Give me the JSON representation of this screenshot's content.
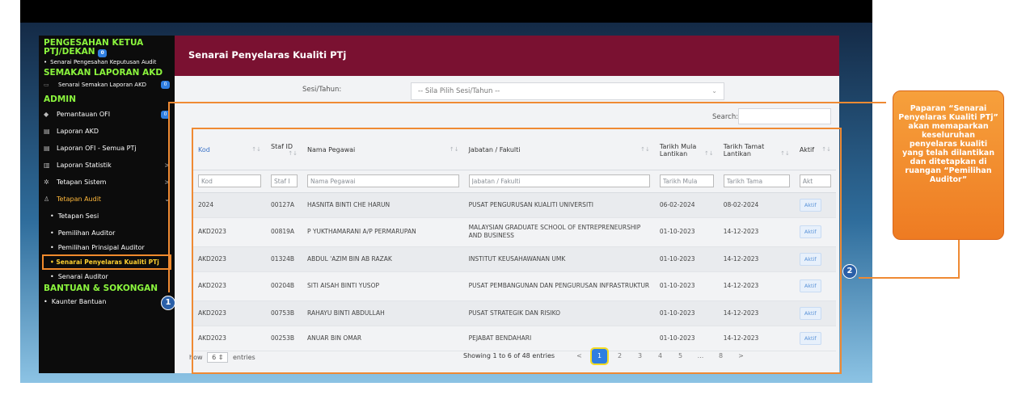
{
  "sidebar": {
    "section1": {
      "title": "PENGESAHAN KETUA PTJ/DEKAN",
      "badge": "0",
      "item": "Senarai Pengesahan Keputusan Audit"
    },
    "section2": {
      "title": "SEMAKAN LAPORAN AKD",
      "item": "Senarai Semakan Laporan AKD",
      "badge": "0"
    },
    "section3": {
      "title": "ADMIN"
    },
    "admin_items": [
      {
        "label": "Pemantauan OFI",
        "badge": "0"
      },
      {
        "label": "Laporan AKD"
      },
      {
        "label": "Laporan OFI - Semua PTj"
      },
      {
        "label": "Laporan Statistik",
        "arrow": ">"
      },
      {
        "label": "Tetapan Sistem",
        "arrow": ">"
      },
      {
        "label": "Tetapan Audit",
        "arrow": "⌄"
      }
    ],
    "audit_sub": [
      "Tetapan Sesi",
      "Pemilihan Auditor",
      "Pemilihan Prinsipal Auditor"
    ],
    "active_item": "Senarai Penyelaras Kualiti PTj",
    "after_active": "Senarai Auditor",
    "section4": {
      "title": "BANTUAN & SOKONGAN",
      "item": "Kaunter Bantuan"
    }
  },
  "main": {
    "title": "Senarai Penyelaras Kualiti PTj",
    "filter_label": "Sesi/Tahun:",
    "filter_placeholder": "-- Sila Pilih Sesi/Tahun --",
    "search_label": "Search:"
  },
  "table": {
    "headers": [
      "Kod",
      "Staf ID",
      "Nama Pegawai",
      "Jabatan / Fakulti",
      "Tarikh Mula Lantikan",
      "Tarikh Tamat Lantikan",
      "Aktif"
    ],
    "filter_placeholders": [
      "Kod",
      "Staf I",
      "Nama Pegawai",
      "Jabatan / Fakulti",
      "Tarikh Mula",
      "Tarikh Tama",
      "Akt"
    ],
    "rows": [
      [
        "2024",
        "00127A",
        "HASNITA BINTI CHE HARUN",
        "PUSAT PENGURUSAN KUALITI UNIVERSITI",
        "06-02-2024",
        "08-02-2024",
        "Aktif"
      ],
      [
        "AKD2023",
        "00819A",
        "P YUKTHAMARANI A/P PERMARUPAN",
        "MALAYSIAN GRADUATE SCHOOL OF ENTREPRENEURSHIP AND BUSINESS",
        "01-10-2023",
        "14-12-2023",
        "Aktif"
      ],
      [
        "AKD2023",
        "01324B",
        "ABDUL 'AZIM BIN AB RAZAK",
        "INSTITUT KEUSAHAWANAN UMK",
        "01-10-2023",
        "14-12-2023",
        "Aktif"
      ],
      [
        "AKD2023",
        "00204B",
        "SITI AISAH BINTI YUSOP",
        "PUSAT PEMBANGUNAN DAN PENGURUSAN INFRASTRUKTUR",
        "01-10-2023",
        "14-12-2023",
        "Aktif"
      ],
      [
        "AKD2023",
        "00753B",
        "RAHAYU BINTI ABDULLAH",
        "PUSAT STRATEGIK DAN RISIKO",
        "01-10-2023",
        "14-12-2023",
        "Aktif"
      ],
      [
        "AKD2023",
        "00253B",
        "ANUAR BIN OMAR",
        "PEJABAT BENDAHARI",
        "01-10-2023",
        "14-12-2023",
        "Aktif"
      ]
    ]
  },
  "footer": {
    "show_prefix": "how",
    "show_value": "6",
    "show_suffix": "entries",
    "info": "Showing 1 to 6 of 48 entries",
    "pages": [
      "<",
      "1",
      "2",
      "3",
      "4",
      "5",
      "...",
      "8",
      ">"
    ]
  },
  "annotations": {
    "marker1": "1",
    "marker2": "2",
    "callout": "Paparan “Senarai Penyelaras Kualiti PTj” akan memaparkan keseluruhan penyelaras kualiti yang telah dilantikan dan ditetapkan di ruangan “Pemilihan Auditor”"
  },
  "colors": {
    "header_bg": "#7a1131",
    "sidebar_bg": "#0c0c0c",
    "sidebar_heading": "#8bf53d",
    "accent": "#2f7ee0",
    "annotation": "#ef8a33"
  }
}
